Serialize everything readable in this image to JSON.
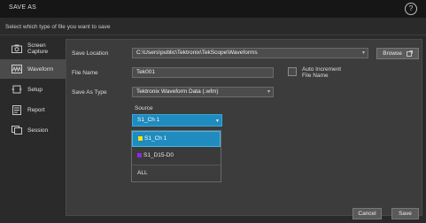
{
  "window": {
    "title": "SAVE AS",
    "help_symbol": "?",
    "prompt": "Select which type of file you want to save"
  },
  "sidebar": {
    "items": [
      {
        "label": "Screen Capture",
        "icon": "camera-icon"
      },
      {
        "label": "Waveform",
        "icon": "waveform-icon",
        "active": true
      },
      {
        "label": "Setup",
        "icon": "setup-icon"
      },
      {
        "label": "Report",
        "icon": "report-icon"
      },
      {
        "label": "Session",
        "icon": "session-icon"
      }
    ]
  },
  "form": {
    "save_location_label": "Save Location",
    "save_location_value": "C:\\Users\\public\\Tektronix\\TekScope\\Waveforms",
    "browse_label": "Browse",
    "file_name_label": "File Name",
    "file_name_value": "Tek001",
    "auto_increment_label": "Auto Increment File Name",
    "save_as_type_label": "Save As Type",
    "save_as_type_value": "Tektronix Waveform Data (.wfm)",
    "source_label": "Source",
    "source_value": "S1_Ch 1",
    "source_options": [
      "S1_Ch 1",
      "S1_D15-D0",
      "ALL"
    ]
  },
  "footer": {
    "cancel_label": "Cancel",
    "save_label": "Save"
  },
  "colors": {
    "accent": "#1f8bbf",
    "ch1": "#f2e600",
    "digital": "#8a2be2"
  }
}
